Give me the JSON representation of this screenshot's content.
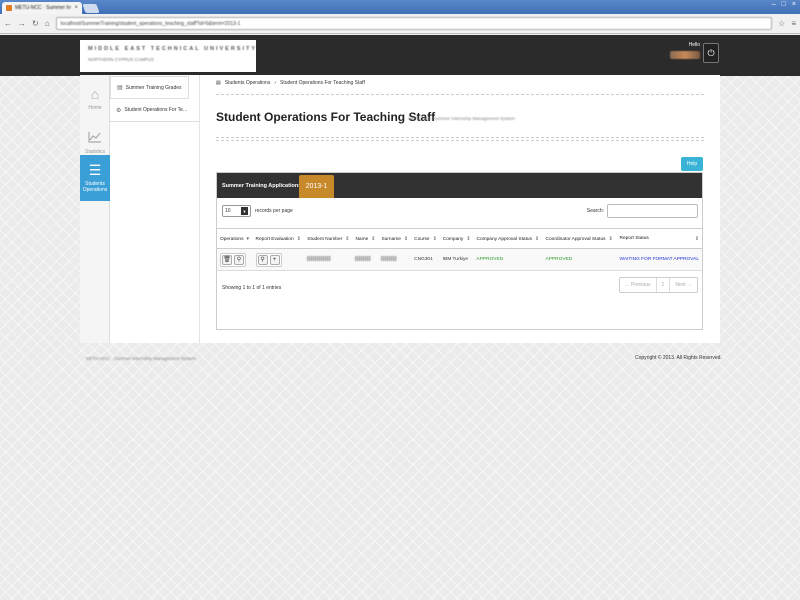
{
  "browser": {
    "tab_title": "METU-NCC · Summer Intern",
    "tab_close": "×",
    "url": "localhost/SummerTraining/student_operations_teaching_staff?id=5&term=2013-1",
    "window_controls": [
      "–",
      "□",
      "×"
    ]
  },
  "header": {
    "university_name": "MIDDLE EAST TECHNICAL UNIVERSITY",
    "university_sub": "NORTHERN CYPRUS CAMPUS",
    "hello_label": "Hello",
    "power_icon": "⏻"
  },
  "rail": {
    "home_label": "Home",
    "statistics_label": "Statistics",
    "operations_label": "Students Operations"
  },
  "subnav": {
    "items": [
      {
        "label": "Summer Training Grades",
        "icon": "▤"
      },
      {
        "label": "Student Operations For Te...",
        "icon": "⚙"
      }
    ]
  },
  "breadcrumb": {
    "root": "Students Operations",
    "separator": "›",
    "current": "Student Operations For Teaching Staff"
  },
  "page": {
    "title": "Student Operations For Teaching Staff",
    "subtitle": "METU-NCC Summer Internship Management System",
    "help_label": "Help"
  },
  "table_box": {
    "title": "Summer Training Applications",
    "year": "2013-1",
    "length_value": "10",
    "length_suffix": "records per page",
    "search_label": "Search:",
    "columns": [
      "Operations",
      "Report Evaluation",
      "Student Number",
      "Name",
      "Surname",
      "Course",
      "Company",
      "Company Approval Status",
      "Coordinator Approval Status",
      "Report Status"
    ],
    "rows": [
      {
        "course": "CNG301",
        "company": "IBM Turkiye",
        "company_status": "APPROVED",
        "coordinator_status": "APPROVED",
        "report_status": "WAITING FOR FORMAT APPROVAL"
      }
    ],
    "info": "Showing 1 to 1 of 1 entries",
    "pager": {
      "prev": "← Previous",
      "page": "1",
      "next": "Next →"
    }
  },
  "footer": {
    "left": "METU-NCC · Summer Internship Management System",
    "right": "Copyright © 2013. All Rights Reserved."
  },
  "colors": {
    "accent": "#3a9fd6",
    "year_badge": "#c8892a",
    "approved": "#2a9a2a",
    "waiting": "#1b2fcf",
    "header_bg": "#2b2b2b"
  }
}
